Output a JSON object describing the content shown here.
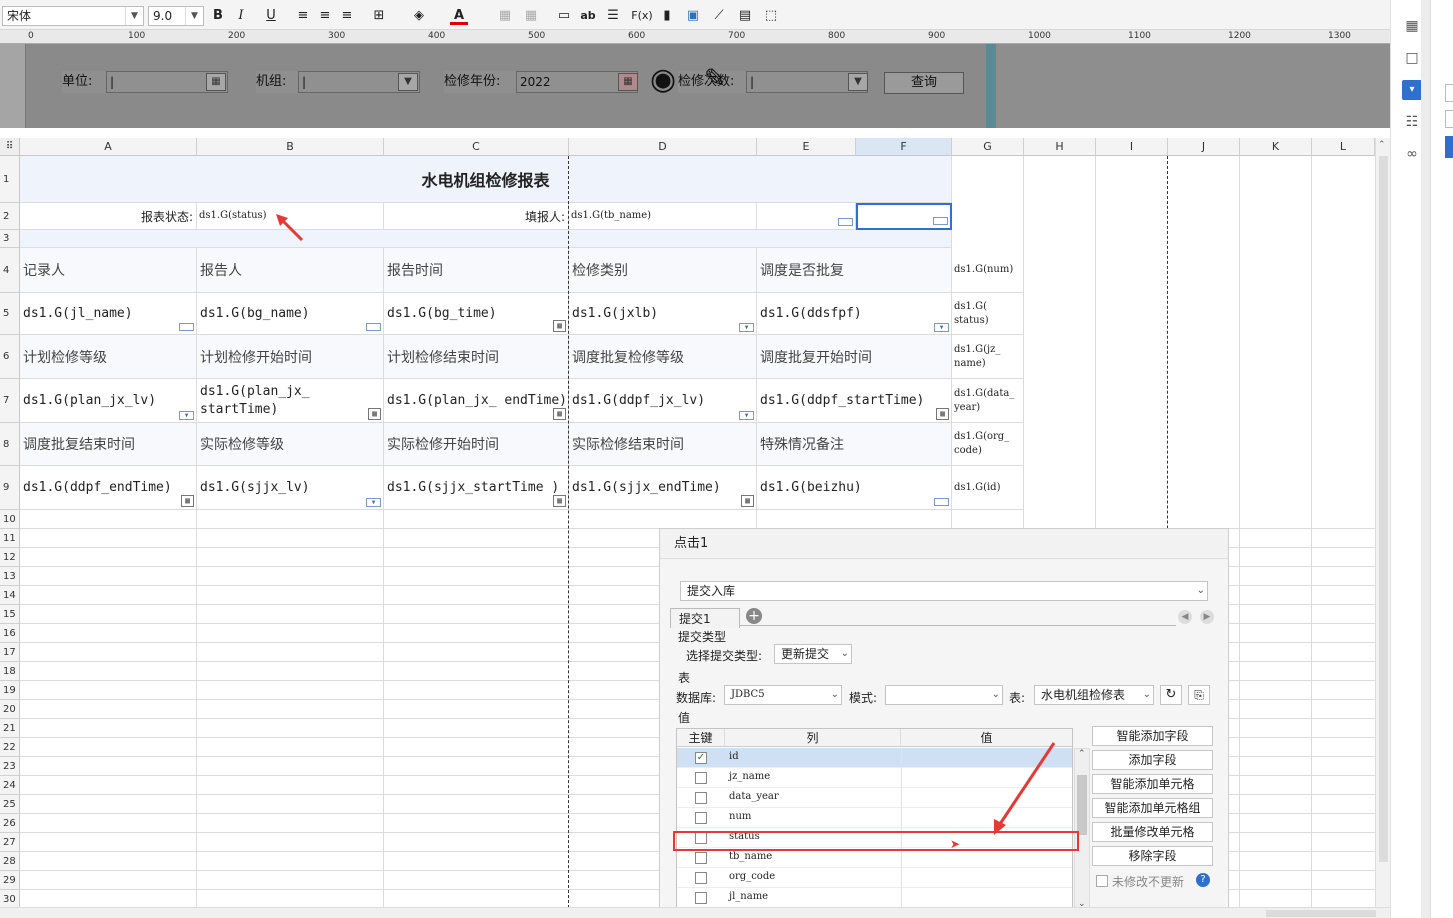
{
  "toolbar": {
    "font": "宋体",
    "size": "9.0",
    "bold": "B",
    "italic": "I",
    "underline": "U",
    "ab": "ab",
    "fx": "F(x)"
  },
  "ruler": {
    "ticks": [
      "0",
      "100",
      "200",
      "300",
      "400",
      "500",
      "600",
      "700",
      "800",
      "900",
      "1000",
      "1100",
      "1200",
      "1300"
    ]
  },
  "params": {
    "unit_label": "单位:",
    "unit_cursor": "|",
    "crew_label": "机组:",
    "crew_cursor": "|",
    "year_label": "检修年份:",
    "year_value": "2022",
    "count_label": "检修次数:",
    "count_cursor": "|",
    "query_btn": "查询"
  },
  "columns": [
    "A",
    "B",
    "C",
    "D",
    "E",
    "F",
    "G",
    "H",
    "I",
    "J",
    "K",
    "L"
  ],
  "rows": [
    "1",
    "2",
    "3",
    "4",
    "5",
    "6",
    "7",
    "8",
    "9",
    "10",
    "11",
    "12",
    "13",
    "14",
    "15",
    "16",
    "17",
    "18",
    "19",
    "20",
    "21",
    "22",
    "23",
    "24",
    "25",
    "26",
    "27",
    "28",
    "29",
    "30"
  ],
  "sheet": {
    "title": "水电机组检修报表",
    "row2": {
      "status_label": "报表状态:",
      "status_val": "ds1.G(status)",
      "filler_label": "填报人:",
      "filler_val": "ds1.G(tb_name)"
    },
    "row4": [
      "记录人",
      "报告人",
      "报告时间",
      "检修类别",
      "调度是否批复"
    ],
    "row5": [
      "ds1.G(jl_name)",
      "ds1.G(bg_name)",
      "ds1.G(bg_time)",
      "ds1.G(jxlb)",
      "ds1.G(ddsfpf)"
    ],
    "row6": [
      "计划检修等级",
      "计划检修开始时间",
      "计划检修结束时间",
      "调度批复检修等级",
      "调度批复开始时间"
    ],
    "row7": [
      "ds1.G(plan_jx_lv)",
      "ds1.G(plan_jx_ startTime)",
      "ds1.G(plan_jx_ endTime)",
      "ds1.G(ddpf_jx_lv)",
      "ds1.G(ddpf_startTime)"
    ],
    "row8": [
      "调度批复结束时间",
      "实际检修等级",
      "实际检修开始时间",
      "实际检修结束时间",
      "特殊情况备注"
    ],
    "row9": [
      "ds1.G(ddpf_endTime)",
      "ds1.G(sjjx_lv)",
      "ds1.G(sjjx_startTime )",
      "ds1.G(sjjx_endTime)",
      "ds1.G(beizhu)"
    ],
    "gcol": [
      "ds1.G(num)",
      "ds1.G( status)",
      "ds1.G(jz_ name)",
      "ds1.G(data_ year)",
      "ds1.G(org_ code)",
      "ds1.G(id)"
    ]
  },
  "panel": {
    "title": "点击1",
    "action": "提交入库",
    "tab": "提交1",
    "submit_type_heading": "提交类型",
    "submit_type_label": "选择提交类型:",
    "submit_type_value": "更新提交",
    "table_heading": "表",
    "db_label": "数据库:",
    "db_value": "JDBC5",
    "mode_label": "模式:",
    "mode_value": "",
    "table_label": "表:",
    "table_value": "水电机组检修表",
    "value_heading": "值",
    "headers": [
      "主键",
      "列",
      "值"
    ],
    "fields": [
      {
        "name": "id",
        "checked": "✓"
      },
      {
        "name": "jz_name",
        "checked": ""
      },
      {
        "name": "data_year",
        "checked": ""
      },
      {
        "name": "num",
        "checked": ""
      },
      {
        "name": "status",
        "checked": ""
      },
      {
        "name": "tb_name",
        "checked": ""
      },
      {
        "name": "org_code",
        "checked": ""
      },
      {
        "name": "jl_name",
        "checked": ""
      }
    ],
    "buttons": [
      "智能添加字段",
      "添加字段",
      "智能添加单元格",
      "智能添加单元格组",
      "批量修改单元格",
      "移除字段"
    ],
    "unmodified": "未修改不更新"
  },
  "colors": {
    "accent": "#3a7bd5",
    "annotation": "#e53935",
    "selection": "#2f6fce"
  }
}
